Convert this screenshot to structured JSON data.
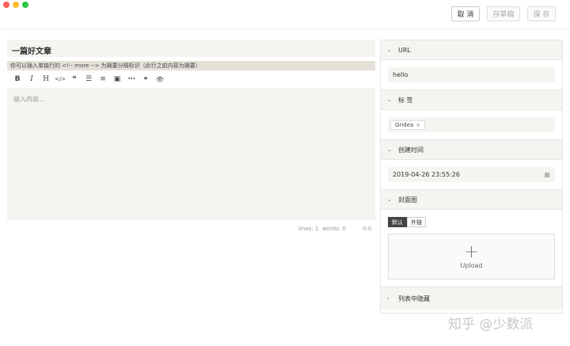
{
  "window": {
    "traffic_lights": [
      "close",
      "minimize",
      "maximize"
    ]
  },
  "topbar": {
    "cancel": "取 消",
    "draft": "存草稿",
    "save": "保 存"
  },
  "editor": {
    "title": "一篇好文章",
    "hint": "你可以插入单独行的 <!-- more --> 为摘要分隔标识（此行之前内容为摘要）",
    "placeholder": "输入内容...",
    "toolbar": [
      "B",
      "I",
      "H",
      "</>",
      "❝",
      "☰",
      "≡",
      "▣",
      "⋯",
      "⚭",
      "👁"
    ],
    "stats": {
      "lines": "lines: 1",
      "words": "words: 0",
      "cursor": "0:0"
    }
  },
  "sidebar": {
    "url": {
      "label": "URL",
      "value": "hello"
    },
    "tags": {
      "label": "标 签",
      "items": [
        "Gridea"
      ]
    },
    "created": {
      "label": "创建时间",
      "value": "2019-04-26 23:55:26"
    },
    "cover": {
      "label": "封面图",
      "tabs": [
        "默认",
        "外链"
      ],
      "upload_label": "Upload"
    },
    "hidden": {
      "label": "列表中隐藏"
    }
  },
  "watermark": "知乎 @少数派"
}
